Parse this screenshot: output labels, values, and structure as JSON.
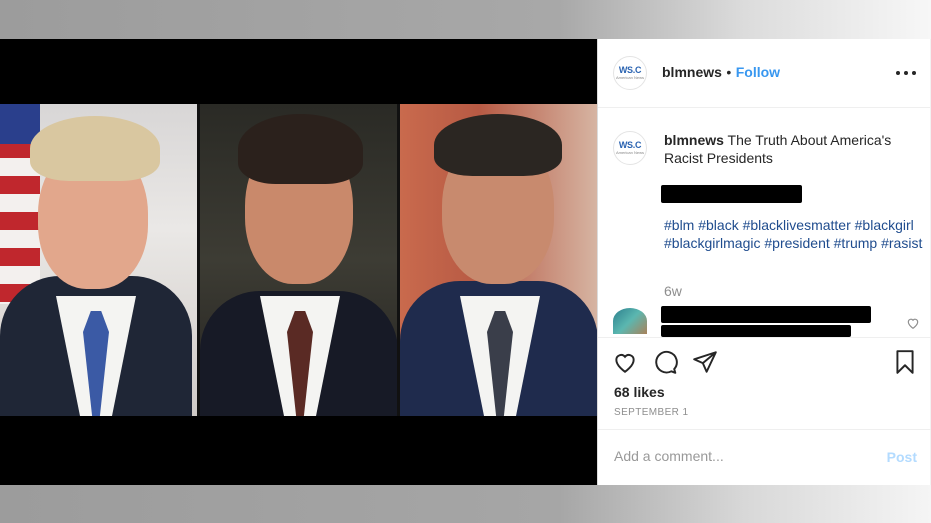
{
  "post": {
    "username": "blmnews",
    "separator": "•",
    "follow_label": "Follow",
    "avatar_text": "WS.C",
    "avatar_subtext": "American News",
    "caption_username": "blmnews",
    "caption_text": "The Truth About America's Racist Presidents",
    "hashtags": "#blm #black #blacklivesmatter #blackgirl #blackgirlmagic #president #trump #rasist",
    "age": "6w",
    "likes": "68 likes",
    "date": "SEPTEMBER 1",
    "comment_placeholder": "Add a comment...",
    "post_label": "Post"
  },
  "icons": {
    "more": "more-options-icon",
    "like": "heart-icon",
    "comment": "comment-icon",
    "share": "paper-plane-icon",
    "save": "bookmark-icon",
    "comment_like": "small-heart-icon"
  },
  "colors": {
    "link_blue": "#3897f0",
    "hashtag_blue": "#1f4c8e",
    "post_disabled": "#b3dbff",
    "text": "#262626",
    "muted": "#8e8e8e"
  }
}
